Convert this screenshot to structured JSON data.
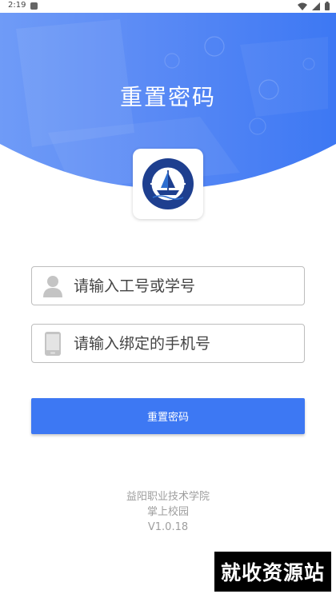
{
  "status_bar": {
    "time": "2:19"
  },
  "header": {
    "title": "重置密码"
  },
  "form": {
    "account_placeholder": "请输入工号或学号",
    "phone_placeholder": "请输入绑定的手机号",
    "submit_label": "重置密码"
  },
  "footer": {
    "school": "益阳职业技术学院",
    "app_name": "掌上校园",
    "version": "V1.0.18"
  },
  "watermark": {
    "text": "就收资源站"
  },
  "icons": {
    "account": "user-icon",
    "phone": "phone-icon",
    "wifi": "wifi-icon",
    "signal": "signal-icon",
    "battery": "battery-icon"
  },
  "colors": {
    "primary": "#3d78f3",
    "hero_light": "#6f9bf7",
    "icon_gray": "#c4c4c4",
    "footer_text": "#9e9e9e"
  }
}
